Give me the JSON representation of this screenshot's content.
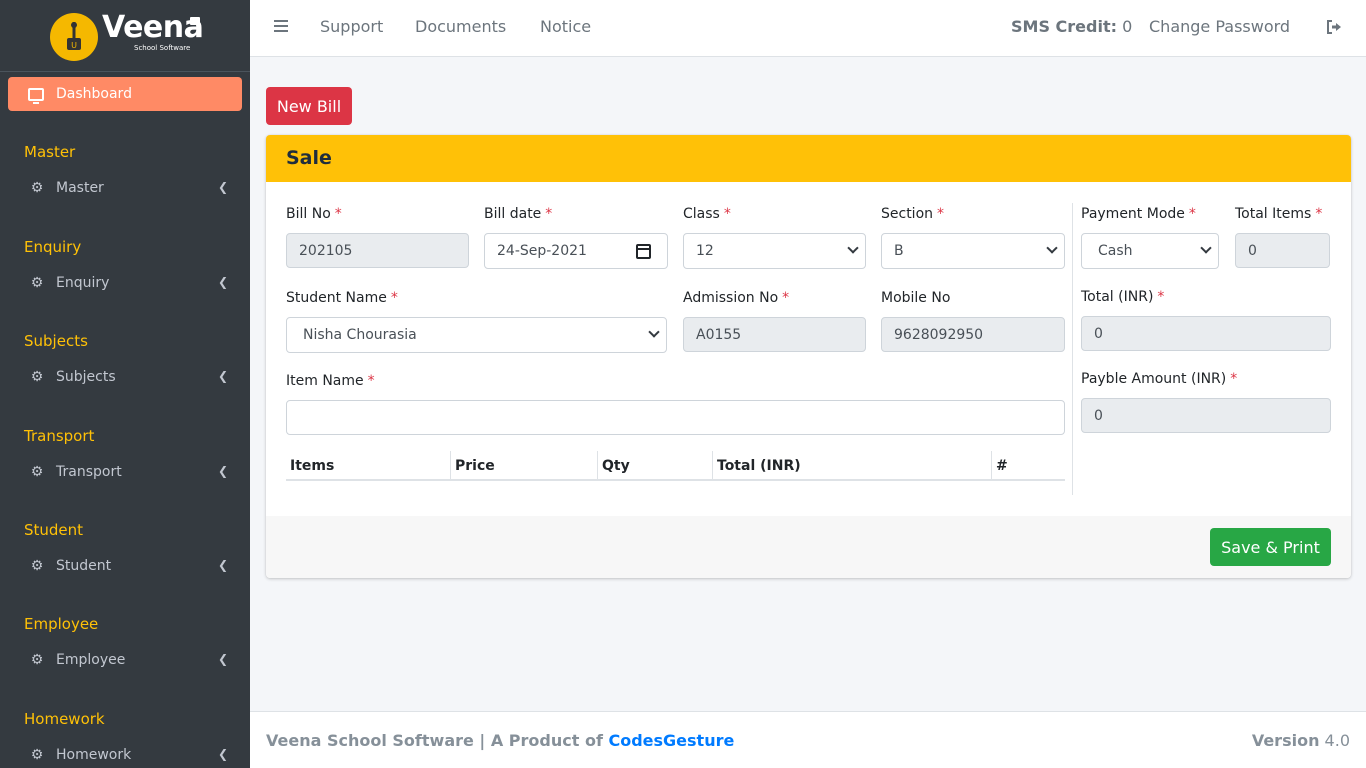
{
  "brand": {
    "name": "Veena",
    "subtitle": "School Software"
  },
  "sidebar": {
    "dashboard": "Dashboard",
    "sections": [
      {
        "header": "Master",
        "item": "Master"
      },
      {
        "header": "Enquiry",
        "item": "Enquiry"
      },
      {
        "header": "Subjects",
        "item": "Subjects"
      },
      {
        "header": "Transport",
        "item": "Transport"
      },
      {
        "header": "Student",
        "item": "Student"
      },
      {
        "header": "Employee",
        "item": "Employee"
      },
      {
        "header": "Homework",
        "item": "Homework"
      }
    ]
  },
  "topbar": {
    "links": [
      "Support",
      "Documents",
      "Notice"
    ],
    "sms_label": "SMS Credit:",
    "sms_value": "0",
    "change_password": "Change Password"
  },
  "actions": {
    "new_bill": "New Bill",
    "save_print": "Save & Print"
  },
  "form": {
    "title": "Sale",
    "bill_no": {
      "label": "Bill No",
      "value": "202105"
    },
    "bill_date": {
      "label": "Bill date",
      "value": "24-Sep-2021"
    },
    "class": {
      "label": "Class",
      "value": "12"
    },
    "section": {
      "label": "Section",
      "value": "B"
    },
    "payment_mode": {
      "label": "Payment Mode",
      "value": "Cash"
    },
    "total_items": {
      "label": "Total Items",
      "value": "0"
    },
    "student_name": {
      "label": "Student Name",
      "value": "Nisha Chourasia"
    },
    "admission_no": {
      "label": "Admission No",
      "value": "A0155"
    },
    "mobile_no": {
      "label": "Mobile No",
      "value": "9628092950"
    },
    "total_inr": {
      "label": "Total (INR)",
      "value": "0"
    },
    "item_name": {
      "label": "Item Name",
      "value": ""
    },
    "payable_amount": {
      "label": "Payble Amount (INR)",
      "value": "0"
    },
    "required_mark": "*",
    "table_headers": [
      "Items",
      "Price",
      "Qty",
      "Total (INR)",
      "#"
    ]
  },
  "footer": {
    "product_text": "Veena School Software | A Product of",
    "company": "CodesGesture",
    "version_label": "Version",
    "version_value": "4.0"
  },
  "colors": {
    "sidebar_bg": "#343a40",
    "accent_yellow": "#ffc107",
    "dashboard_active": "#ff8a65",
    "new_bill": "#dc3545",
    "save_print": "#28a745",
    "link_blue": "#007bff"
  }
}
